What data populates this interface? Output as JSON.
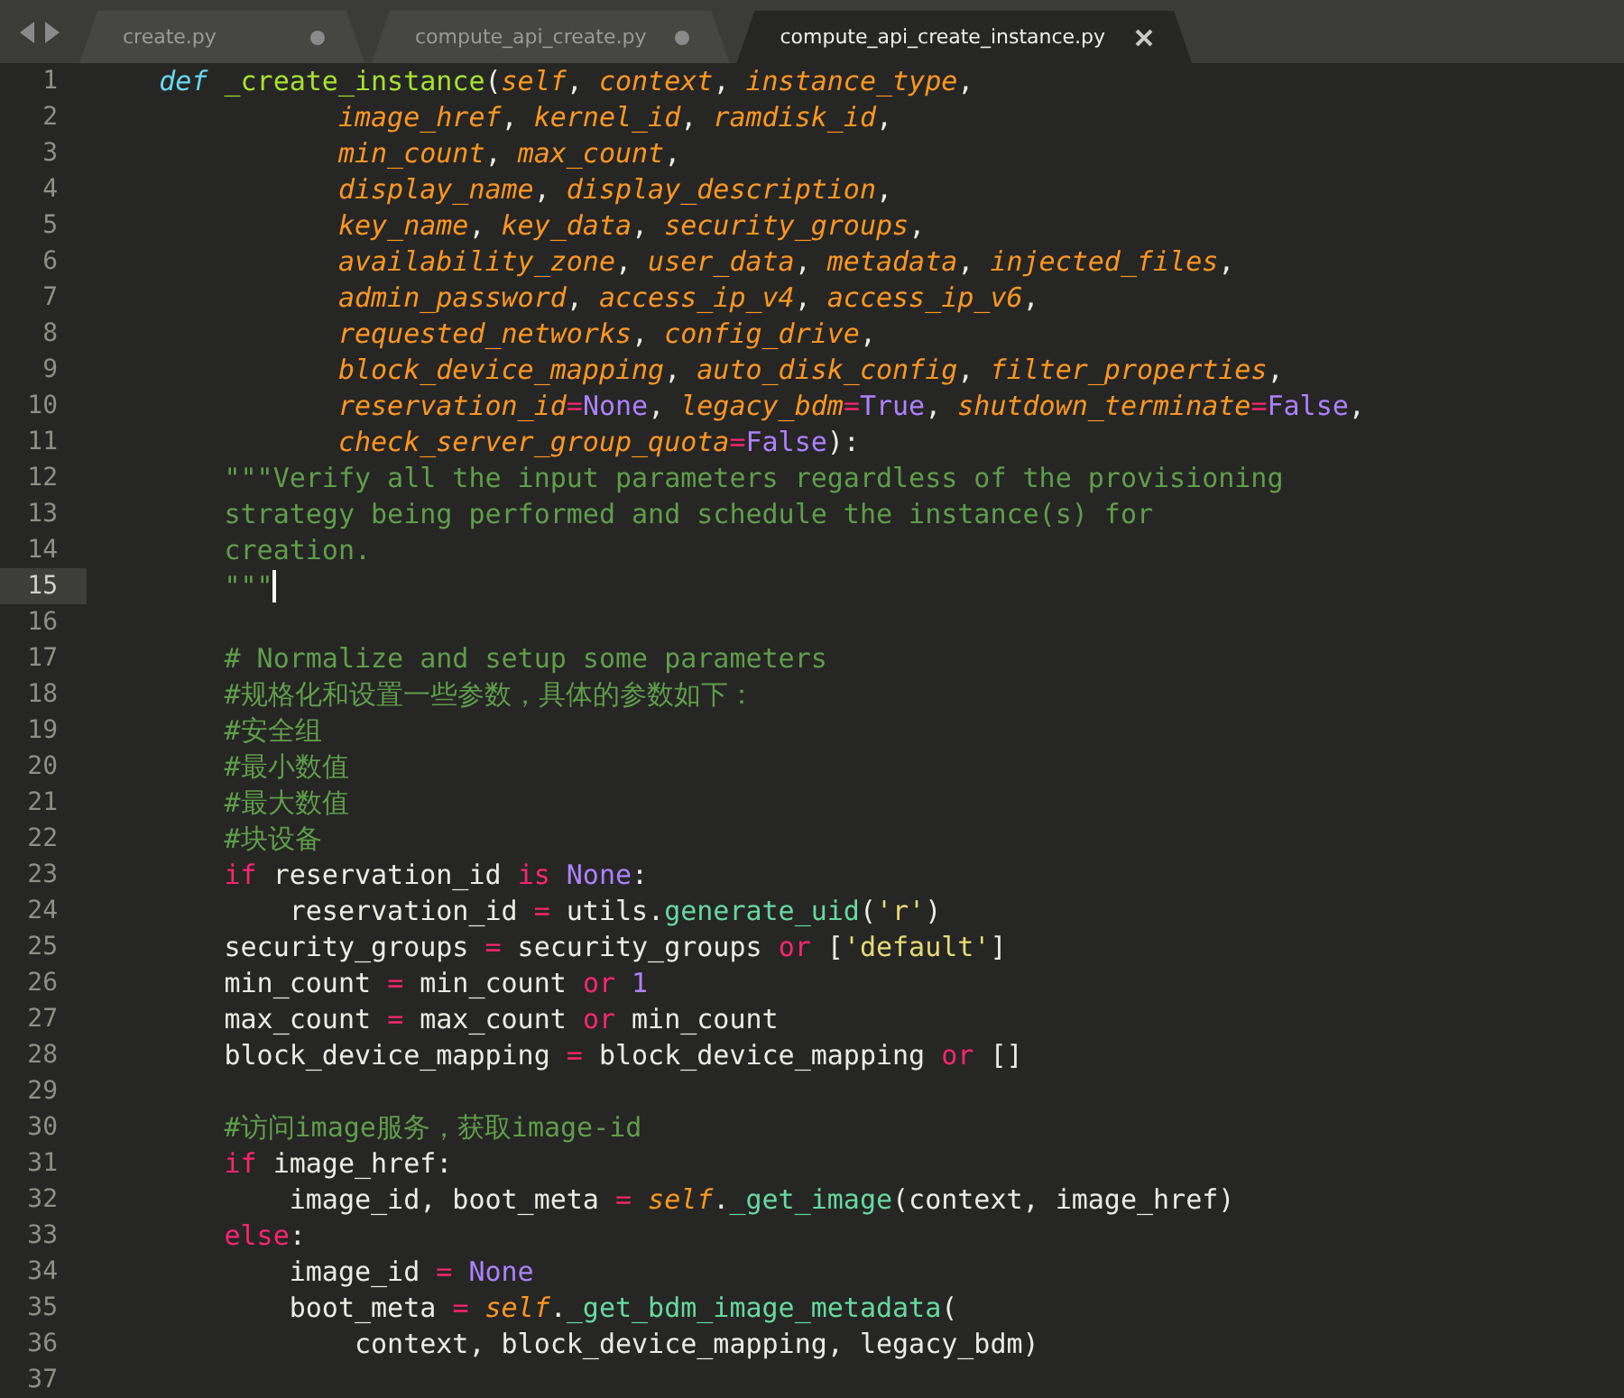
{
  "tabs": [
    {
      "label": "create.py",
      "selected": false,
      "modified": true
    },
    {
      "label": "compute_api_create.py",
      "selected": false,
      "modified": true
    },
    {
      "label": "compute_api_create_instance.py",
      "selected": true,
      "modified": false
    }
  ],
  "lines": [
    {
      "number": "1",
      "current": false,
      "tokens": [
        {
          "kind": "storage",
          "text": "    def "
        },
        {
          "kind": "fn",
          "text": "_create_instance"
        },
        {
          "kind": "plain",
          "text": "("
        },
        {
          "kind": "param",
          "text": "self"
        },
        {
          "kind": "plain",
          "text": ", "
        },
        {
          "kind": "param",
          "text": "context"
        },
        {
          "kind": "plain",
          "text": ", "
        },
        {
          "kind": "param",
          "text": "instance_type"
        },
        {
          "kind": "plain",
          "text": ","
        }
      ]
    },
    {
      "number": "2",
      "current": false,
      "tokens": [
        {
          "kind": "param",
          "text": "               image_href"
        },
        {
          "kind": "plain",
          "text": ", "
        },
        {
          "kind": "param",
          "text": "kernel_id"
        },
        {
          "kind": "plain",
          "text": ", "
        },
        {
          "kind": "param",
          "text": "ramdisk_id"
        },
        {
          "kind": "plain",
          "text": ","
        }
      ]
    },
    {
      "number": "3",
      "current": false,
      "tokens": [
        {
          "kind": "param",
          "text": "               min_count"
        },
        {
          "kind": "plain",
          "text": ", "
        },
        {
          "kind": "param",
          "text": "max_count"
        },
        {
          "kind": "plain",
          "text": ","
        }
      ]
    },
    {
      "number": "4",
      "current": false,
      "tokens": [
        {
          "kind": "param",
          "text": "               display_name"
        },
        {
          "kind": "plain",
          "text": ", "
        },
        {
          "kind": "param",
          "text": "display_description"
        },
        {
          "kind": "plain",
          "text": ","
        }
      ]
    },
    {
      "number": "5",
      "current": false,
      "tokens": [
        {
          "kind": "param",
          "text": "               key_name"
        },
        {
          "kind": "plain",
          "text": ", "
        },
        {
          "kind": "param",
          "text": "key_data"
        },
        {
          "kind": "plain",
          "text": ", "
        },
        {
          "kind": "param",
          "text": "security_groups"
        },
        {
          "kind": "plain",
          "text": ","
        }
      ]
    },
    {
      "number": "6",
      "current": false,
      "tokens": [
        {
          "kind": "param",
          "text": "               availability_zone"
        },
        {
          "kind": "plain",
          "text": ", "
        },
        {
          "kind": "param",
          "text": "user_data"
        },
        {
          "kind": "plain",
          "text": ", "
        },
        {
          "kind": "param",
          "text": "metadata"
        },
        {
          "kind": "plain",
          "text": ", "
        },
        {
          "kind": "param",
          "text": "injected_files"
        },
        {
          "kind": "plain",
          "text": ","
        }
      ]
    },
    {
      "number": "7",
      "current": false,
      "tokens": [
        {
          "kind": "param",
          "text": "               admin_password"
        },
        {
          "kind": "plain",
          "text": ", "
        },
        {
          "kind": "param",
          "text": "access_ip_v4"
        },
        {
          "kind": "plain",
          "text": ", "
        },
        {
          "kind": "param",
          "text": "access_ip_v6"
        },
        {
          "kind": "plain",
          "text": ","
        }
      ]
    },
    {
      "number": "8",
      "current": false,
      "tokens": [
        {
          "kind": "param",
          "text": "               requested_networks"
        },
        {
          "kind": "plain",
          "text": ", "
        },
        {
          "kind": "param",
          "text": "config_drive"
        },
        {
          "kind": "plain",
          "text": ","
        }
      ]
    },
    {
      "number": "9",
      "current": false,
      "tokens": [
        {
          "kind": "param",
          "text": "               block_device_mapping"
        },
        {
          "kind": "plain",
          "text": ", "
        },
        {
          "kind": "param",
          "text": "auto_disk_config"
        },
        {
          "kind": "plain",
          "text": ", "
        },
        {
          "kind": "param",
          "text": "filter_properties"
        },
        {
          "kind": "plain",
          "text": ","
        }
      ]
    },
    {
      "number": "10",
      "current": false,
      "tokens": [
        {
          "kind": "param",
          "text": "               reservation_id"
        },
        {
          "kind": "op",
          "text": "="
        },
        {
          "kind": "const",
          "text": "None"
        },
        {
          "kind": "plain",
          "text": ", "
        },
        {
          "kind": "param",
          "text": "legacy_bdm"
        },
        {
          "kind": "op",
          "text": "="
        },
        {
          "kind": "const",
          "text": "True"
        },
        {
          "kind": "plain",
          "text": ", "
        },
        {
          "kind": "param",
          "text": "shutdown_terminate"
        },
        {
          "kind": "op",
          "text": "="
        },
        {
          "kind": "const",
          "text": "False"
        },
        {
          "kind": "plain",
          "text": ","
        }
      ]
    },
    {
      "number": "11",
      "current": false,
      "tokens": [
        {
          "kind": "param",
          "text": "               check_server_group_quota"
        },
        {
          "kind": "op",
          "text": "="
        },
        {
          "kind": "const",
          "text": "False"
        },
        {
          "kind": "plain",
          "text": "):"
        }
      ]
    },
    {
      "number": "12",
      "current": false,
      "tokens": [
        {
          "kind": "comment",
          "text": "        \"\"\"Verify all the input parameters regardless of the provisioning"
        }
      ]
    },
    {
      "number": "13",
      "current": false,
      "tokens": [
        {
          "kind": "comment",
          "text": "        strategy being performed and schedule the instance(s) for"
        }
      ]
    },
    {
      "number": "14",
      "current": false,
      "tokens": [
        {
          "kind": "comment",
          "text": "        creation."
        }
      ]
    },
    {
      "number": "15",
      "current": true,
      "cursor": true,
      "tokens": [
        {
          "kind": "comment",
          "text": "        \"\"\""
        }
      ]
    },
    {
      "number": "16",
      "current": false
    },
    {
      "number": "17",
      "current": false,
      "tokens": [
        {
          "kind": "comment",
          "text": "        # Normalize and setup some parameters"
        }
      ]
    },
    {
      "number": "18",
      "current": false,
      "tokens": [
        {
          "kind": "comment",
          "text": "        #规格化和设置一些参数，具体的参数如下："
        }
      ]
    },
    {
      "number": "19",
      "current": false,
      "tokens": [
        {
          "kind": "comment",
          "text": "        #安全组"
        }
      ]
    },
    {
      "number": "20",
      "current": false,
      "tokens": [
        {
          "kind": "comment",
          "text": "        #最小数值"
        }
      ]
    },
    {
      "number": "21",
      "current": false,
      "tokens": [
        {
          "kind": "comment",
          "text": "        #最大数值"
        }
      ]
    },
    {
      "number": "22",
      "current": false,
      "tokens": [
        {
          "kind": "comment",
          "text": "        #块设备"
        }
      ]
    },
    {
      "number": "23",
      "current": false,
      "tokens": [
        {
          "kind": "kw",
          "text": "        if"
        },
        {
          "kind": "plain",
          "text": " reservation_id "
        },
        {
          "kind": "kw",
          "text": "is"
        },
        {
          "kind": "const",
          "text": " None"
        },
        {
          "kind": "plain",
          "text": ":"
        }
      ]
    },
    {
      "number": "24",
      "current": false,
      "tokens": [
        {
          "kind": "plain",
          "text": "            reservation_id "
        },
        {
          "kind": "op",
          "text": "="
        },
        {
          "kind": "plain",
          "text": " utils."
        },
        {
          "kind": "call",
          "text": "generate_uid"
        },
        {
          "kind": "plain",
          "text": "("
        },
        {
          "kind": "str",
          "text": "'r'"
        },
        {
          "kind": "plain",
          "text": ")"
        }
      ]
    },
    {
      "number": "25",
      "current": false,
      "tokens": [
        {
          "kind": "plain",
          "text": "        security_groups "
        },
        {
          "kind": "op",
          "text": "="
        },
        {
          "kind": "plain",
          "text": " security_groups "
        },
        {
          "kind": "kw",
          "text": "or"
        },
        {
          "kind": "plain",
          "text": " ["
        },
        {
          "kind": "str",
          "text": "'default'"
        },
        {
          "kind": "plain",
          "text": "]"
        }
      ]
    },
    {
      "number": "26",
      "current": false,
      "tokens": [
        {
          "kind": "plain",
          "text": "        min_count "
        },
        {
          "kind": "op",
          "text": "="
        },
        {
          "kind": "plain",
          "text": " min_count "
        },
        {
          "kind": "kw",
          "text": "or"
        },
        {
          "kind": "const",
          "text": " 1"
        }
      ]
    },
    {
      "number": "27",
      "current": false,
      "tokens": [
        {
          "kind": "plain",
          "text": "        max_count "
        },
        {
          "kind": "op",
          "text": "="
        },
        {
          "kind": "plain",
          "text": " max_count "
        },
        {
          "kind": "kw",
          "text": "or"
        },
        {
          "kind": "plain",
          "text": " min_count"
        }
      ]
    },
    {
      "number": "28",
      "current": false,
      "tokens": [
        {
          "kind": "plain",
          "text": "        block_device_mapping "
        },
        {
          "kind": "op",
          "text": "="
        },
        {
          "kind": "plain",
          "text": " block_device_mapping "
        },
        {
          "kind": "kw",
          "text": "or"
        },
        {
          "kind": "plain",
          "text": " []"
        }
      ]
    },
    {
      "number": "29",
      "current": false
    },
    {
      "number": "30",
      "current": false,
      "tokens": [
        {
          "kind": "comment",
          "text": "        #访问image服务，获取image-id"
        }
      ]
    },
    {
      "number": "31",
      "current": false,
      "tokens": [
        {
          "kind": "kw",
          "text": "        if"
        },
        {
          "kind": "plain",
          "text": " image_href:"
        }
      ]
    },
    {
      "number": "32",
      "current": false,
      "tokens": [
        {
          "kind": "plain",
          "text": "            image_id, boot_meta "
        },
        {
          "kind": "op",
          "text": "="
        },
        {
          "kind": "self",
          "text": " self"
        },
        {
          "kind": "plain",
          "text": "."
        },
        {
          "kind": "call",
          "text": "_get_image"
        },
        {
          "kind": "plain",
          "text": "(context, image_href)"
        }
      ]
    },
    {
      "number": "33",
      "current": false,
      "tokens": [
        {
          "kind": "kw",
          "text": "        else"
        },
        {
          "kind": "plain",
          "text": ":"
        }
      ]
    },
    {
      "number": "34",
      "current": false,
      "tokens": [
        {
          "kind": "plain",
          "text": "            image_id "
        },
        {
          "kind": "op",
          "text": "="
        },
        {
          "kind": "const",
          "text": " None"
        }
      ]
    },
    {
      "number": "35",
      "current": false,
      "tokens": [
        {
          "kind": "plain",
          "text": "            boot_meta "
        },
        {
          "kind": "op",
          "text": "="
        },
        {
          "kind": "self",
          "text": " self"
        },
        {
          "kind": "plain",
          "text": "."
        },
        {
          "kind": "call",
          "text": "_get_bdm_image_metadata"
        },
        {
          "kind": "plain",
          "text": "("
        }
      ]
    },
    {
      "number": "36",
      "current": false,
      "tokens": [
        {
          "kind": "plain",
          "text": "                context, block_device_mapping, legacy_bdm)"
        }
      ]
    },
    {
      "number": "37",
      "current": false
    }
  ]
}
